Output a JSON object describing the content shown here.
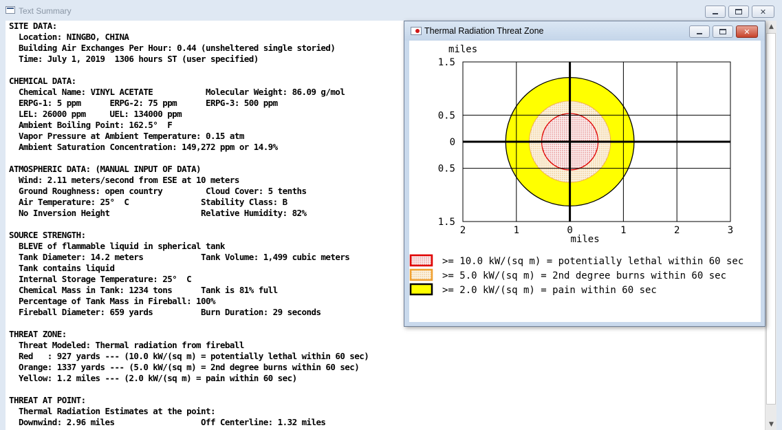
{
  "text_summary": {
    "title": "Text Summary",
    "lines": [
      "SITE DATA:",
      "  Location: NINGBO, CHINA",
      "  Building Air Exchanges Per Hour: 0.44 (unsheltered single storied)",
      "  Time: July 1, 2019  1306 hours ST (user specified)",
      "",
      "CHEMICAL DATA:",
      "  Chemical Name: VINYL ACETATE           Molecular Weight: 86.09 g/mol",
      "  ERPG-1: 5 ppm      ERPG-2: 75 ppm      ERPG-3: 500 ppm",
      "  LEL: 26000 ppm     UEL: 134000 ppm",
      "  Ambient Boiling Point: 162.5°  F",
      "  Vapor Pressure at Ambient Temperature: 0.15 atm",
      "  Ambient Saturation Concentration: 149,272 ppm or 14.9%",
      "",
      "ATMOSPHERIC DATA: (MANUAL INPUT OF DATA)",
      "  Wind: 2.11 meters/second from ESE at 10 meters",
      "  Ground Roughness: open country         Cloud Cover: 5 tenths",
      "  Air Temperature: 25°  C               Stability Class: B",
      "  No Inversion Height                   Relative Humidity: 82%",
      "",
      "SOURCE STRENGTH:",
      "  BLEVE of flammable liquid in spherical tank",
      "  Tank Diameter: 14.2 meters            Tank Volume: 1,499 cubic meters",
      "  Tank contains liquid",
      "  Internal Storage Temperature: 25°  C",
      "  Chemical Mass in Tank: 1234 tons      Tank is 81% full",
      "  Percentage of Tank Mass in Fireball: 100%",
      "  Fireball Diameter: 659 yards          Burn Duration: 29 seconds",
      "",
      "THREAT ZONE:",
      "  Threat Modeled: Thermal radiation from fireball",
      "  Red   : 927 yards --- (10.0 kW/(sq m) = potentially lethal within 60 sec)",
      "  Orange: 1337 yards --- (5.0 kW/(sq m) = 2nd degree burns within 60 sec)",
      "  Yellow: 1.2 miles --- (2.0 kW/(sq m) = pain within 60 sec)",
      "",
      "THREAT AT POINT:",
      "  Thermal Radiation Estimates at the point:",
      "  Downwind: 2.96 miles                  Off Centerline: 1.32 miles"
    ]
  },
  "threat_window": {
    "title": "Thermal Radiation Threat Zone",
    "y_unit_label": "miles",
    "x_unit_label": "miles",
    "y_ticks": [
      {
        "value": 1.5,
        "label": "1.5"
      },
      {
        "value": 0.5,
        "label": "0.5"
      },
      {
        "value": 0,
        "label": "0"
      },
      {
        "value": -0.5,
        "label": "0.5"
      },
      {
        "value": -1.5,
        "label": "1.5"
      }
    ],
    "x_ticks": [
      {
        "value": -2,
        "label": "2"
      },
      {
        "value": -1,
        "label": "1"
      },
      {
        "value": 0,
        "label": "0"
      },
      {
        "value": 1,
        "label": "1"
      },
      {
        "value": 2,
        "label": "2"
      },
      {
        "value": 3,
        "label": "3"
      }
    ],
    "legend": [
      {
        "label": ">= 10.0 kW/(sq m) = potentially lethal within 60 sec",
        "color": "#e00000",
        "fill": "#f3d0d0"
      },
      {
        "label": ">= 5.0 kW/(sq m) = 2nd degree burns within 60 sec",
        "color": "#f0a030",
        "fill": "#f6dfb8"
      },
      {
        "label": ">= 2.0 kW/(sq m) = pain within 60 sec",
        "color": "#000000",
        "fill": "#ffff00"
      }
    ]
  },
  "chart_data": {
    "type": "threat_zone_map",
    "x_unit": "miles",
    "y_unit": "miles",
    "xlim": [
      -2,
      3
    ],
    "ylim": [
      -1.5,
      1.5
    ],
    "x_gridlines": [
      -2,
      -1,
      0,
      1,
      2,
      3
    ],
    "y_gridlines": [
      -1.5,
      -0.5,
      0,
      0.5,
      1.5
    ],
    "zones": [
      {
        "name": "Yellow",
        "radius_miles": 1.2,
        "fill": "#ffff00",
        "stroke": "#000000"
      },
      {
        "name": "Orange",
        "radius_miles": 0.76,
        "fill": "#f6e4c0",
        "stroke": "#f0b050"
      },
      {
        "name": "Red",
        "radius_miles": 0.527,
        "fill": "#f7dede",
        "stroke": "#e00000"
      }
    ]
  }
}
